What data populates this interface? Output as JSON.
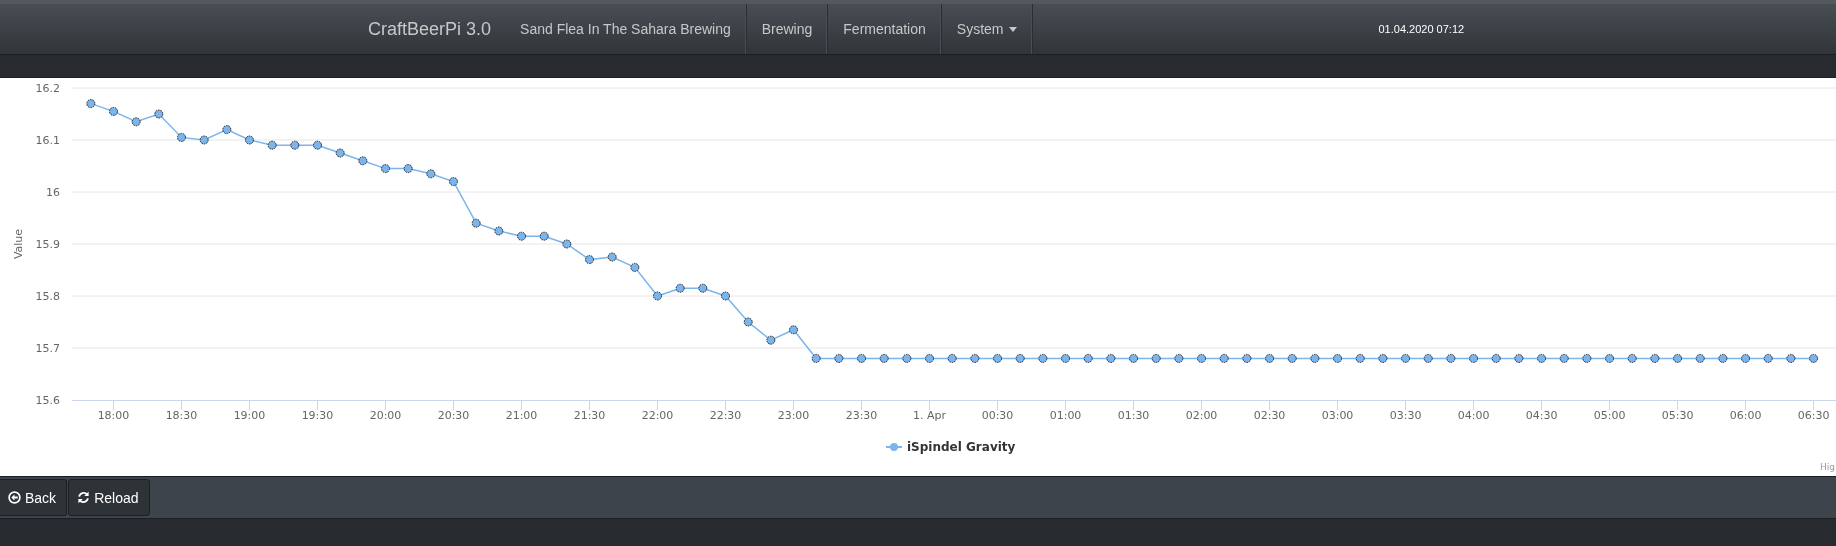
{
  "navbar": {
    "brand": "CraftBeerPi 3.0",
    "items": [
      {
        "label": "Sand Flea In The Sahara Brewing",
        "kind": "link"
      },
      {
        "label": "Brewing",
        "kind": "link"
      },
      {
        "label": "Fermentation",
        "kind": "link"
      },
      {
        "label": "System",
        "kind": "dropdown"
      }
    ],
    "clock": "01.04.2020 07:12"
  },
  "chart": {
    "chart_data": {
      "type": "line",
      "grid": true,
      "ylabel": "Value",
      "categories": [
        null,
        "18:00",
        null,
        null,
        "18:30",
        null,
        null,
        "19:00",
        null,
        null,
        "19:30",
        null,
        null,
        "20:00",
        null,
        null,
        "20:30",
        null,
        null,
        "21:00",
        null,
        null,
        "21:30",
        null,
        null,
        "22:00",
        null,
        null,
        "22:30",
        null,
        null,
        "23:00",
        null,
        null,
        "23:30",
        null,
        null,
        "1. Apr",
        null,
        null,
        "00:30",
        null,
        null,
        "01:00",
        null,
        null,
        "01:30",
        null,
        null,
        "02:00",
        null,
        null,
        "02:30",
        null,
        null,
        "03:00",
        null,
        null,
        "03:30",
        null,
        null,
        "04:00",
        null,
        null,
        "04:30",
        null,
        null,
        "05:00",
        null,
        null,
        "05:30",
        null,
        null,
        "06:00",
        null,
        null,
        "06:30"
      ],
      "series": [
        {
          "name": "iSpindel Gravity",
          "color": "#7cb5ec",
          "marker": true,
          "values": [
            16.17,
            16.155,
            16.135,
            16.15,
            16.105,
            16.1,
            16.12,
            16.1,
            16.09,
            16.09,
            16.09,
            16.075,
            16.06,
            16.045,
            16.045,
            16.035,
            16.02,
            15.94,
            15.925,
            15.915,
            15.915,
            15.9,
            15.87,
            15.875,
            15.855,
            15.8,
            15.815,
            15.815,
            15.8,
            15.75,
            15.715,
            15.735,
            15.68,
            15.68,
            15.68,
            15.68,
            15.68,
            15.68,
            15.68,
            15.68,
            15.68,
            15.68,
            15.68,
            15.68,
            15.68,
            15.68,
            15.68,
            15.68,
            15.68,
            15.68,
            15.68,
            15.68,
            15.68,
            15.68,
            15.68,
            15.68,
            15.68,
            15.68,
            15.68,
            15.68,
            15.68,
            15.68,
            15.68,
            15.68,
            15.68,
            15.68,
            15.68,
            15.68,
            15.68,
            15.68,
            15.68,
            15.68,
            15.68,
            15.68,
            15.68,
            15.68,
            15.68
          ]
        }
      ],
      "ylim": [
        15.6,
        16.2
      ],
      "yticks": [
        15.6,
        15.7,
        15.8,
        15.9,
        16,
        16.1,
        16.2
      ]
    },
    "credits": "Hig"
  },
  "buttons": [
    {
      "label": "Back",
      "kind": "back"
    },
    {
      "label": "Reload",
      "kind": "reload"
    }
  ]
}
